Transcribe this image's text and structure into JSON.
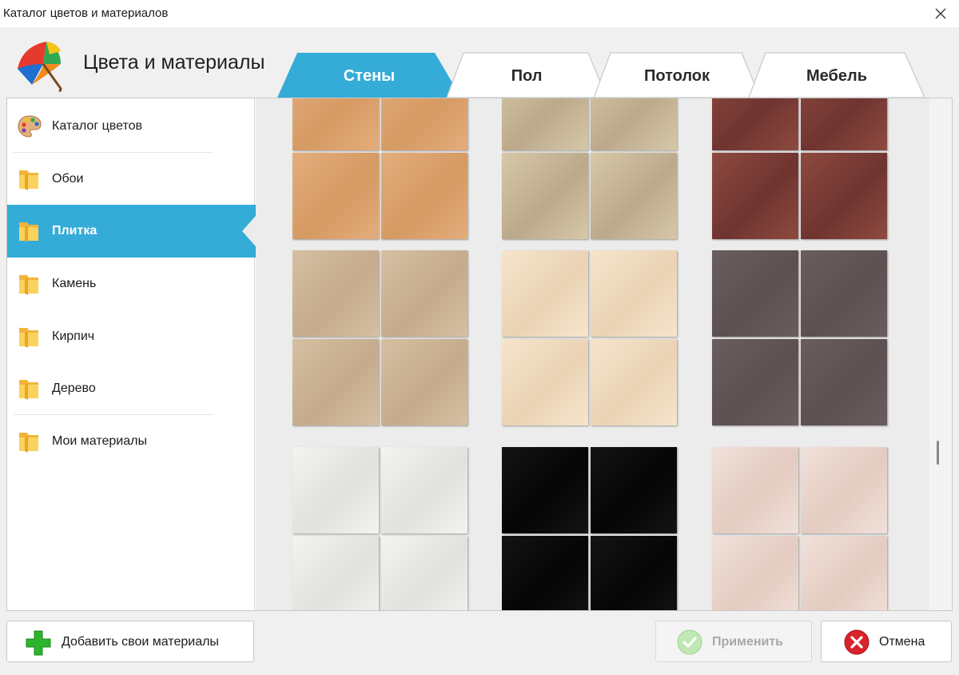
{
  "window": {
    "title": "Каталог цветов и материалов"
  },
  "header": {
    "app_title": "Цвета и материалы",
    "logo_icon": "umbrella-icon"
  },
  "tabs": [
    {
      "label": "Стены",
      "active": true
    },
    {
      "label": "Пол",
      "active": false
    },
    {
      "label": "Потолок",
      "active": false
    },
    {
      "label": "Мебель",
      "active": false
    }
  ],
  "sidebar": {
    "items": [
      {
        "label": "Каталог цветов",
        "icon": "palette-icon"
      },
      {
        "label": "Обои",
        "icon": "folder-icon"
      },
      {
        "label": "Плитка",
        "icon": "folder-icon",
        "active": true
      },
      {
        "label": "Камень",
        "icon": "folder-icon"
      },
      {
        "label": "Кирпич",
        "icon": "folder-icon"
      },
      {
        "label": "Дерево",
        "icon": "folder-icon"
      },
      {
        "label": "Мои материалы",
        "icon": "folder-icon"
      }
    ]
  },
  "materials": [
    {
      "name": "sand-marble-tile",
      "colors": [
        "#e3ad7c",
        "#d69a63"
      ]
    },
    {
      "name": "beige-granite-tile",
      "colors": [
        "#d7c8a8",
        "#bba98a"
      ]
    },
    {
      "name": "red-stone-tile",
      "colors": [
        "#8e4a3f",
        "#6f3430"
      ]
    },
    {
      "name": "taupe-tile",
      "colors": [
        "#d6bfa2",
        "#c5ab8c"
      ]
    },
    {
      "name": "cream-marble-tile",
      "colors": [
        "#f6e4cc",
        "#ead3b4"
      ]
    },
    {
      "name": "dark-grey-tile",
      "colors": [
        "#6a5d5e",
        "#5c5051"
      ]
    },
    {
      "name": "white-marble-tile",
      "colors": [
        "#f4f3ef",
        "#e2e1dc"
      ]
    },
    {
      "name": "black-marble-tile",
      "colors": [
        "#141414",
        "#050505"
      ]
    },
    {
      "name": "pink-marble-tile",
      "colors": [
        "#f1e1da",
        "#e3cbc0"
      ]
    }
  ],
  "footer": {
    "add_label": "Добавить свои материалы",
    "apply_label": "Применить",
    "cancel_label": "Отмена"
  },
  "colors": {
    "accent": "#35acd8",
    "background": "#f0f0f0",
    "add_green": "#2db42d",
    "cancel_red": "#d8232a"
  }
}
